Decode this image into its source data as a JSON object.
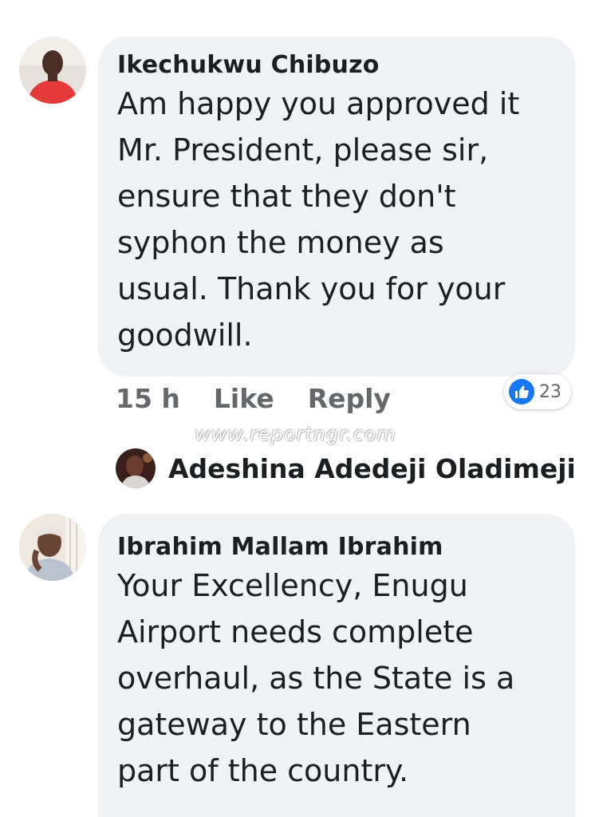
{
  "comments": [
    {
      "author": "Ikechukwu Chibuzo",
      "text": "Am happy you approved it\nMr. President, please sir,\nensure that they don't\nsyphon the money as\nusual. Thank you for your\ngoodwill.",
      "time": "15 h",
      "like_label": "Like",
      "reply_label": "Reply",
      "reaction_count": "23",
      "reaction_icon": "thumbs-up-icon"
    },
    {
      "author": "Ibrahim Mallam Ibrahim",
      "text": "Your Excellency, Enugu\nAirport needs complete\noverhaul, as the State is a\ngateway to the Eastern\npart of the country."
    }
  ],
  "reply_preview": {
    "author": "Adeshina Adedeji Oladimeji"
  },
  "watermark": "www.reportngr.com",
  "colors": {
    "bubble": "#f0f2f5",
    "muted_text": "#65676b",
    "like_blue": "#1877f2"
  }
}
